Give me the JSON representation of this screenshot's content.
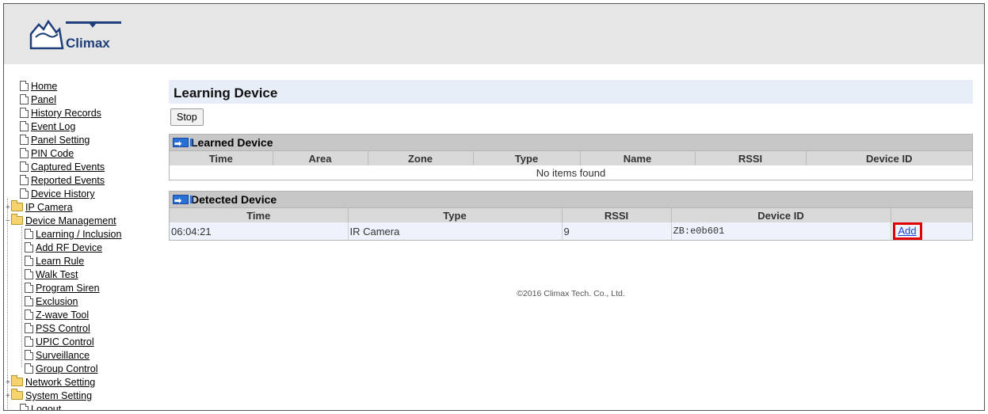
{
  "brand": {
    "logo_text": "Climax"
  },
  "sidebar": {
    "items": [
      {
        "label": "Home"
      },
      {
        "label": "Panel"
      },
      {
        "label": "History Records"
      },
      {
        "label": "Event Log"
      },
      {
        "label": "Panel Setting"
      },
      {
        "label": "PIN Code"
      },
      {
        "label": "Captured Events"
      },
      {
        "label": "Reported Events"
      },
      {
        "label": "Device History"
      },
      {
        "label": "IP Camera"
      },
      {
        "label": "Device Management"
      },
      {
        "label": "Learning / Inclusion"
      },
      {
        "label": "Add RF Device"
      },
      {
        "label": "Learn Rule"
      },
      {
        "label": "Walk Test"
      },
      {
        "label": "Program Siren"
      },
      {
        "label": "Exclusion"
      },
      {
        "label": "Z-wave Tool"
      },
      {
        "label": "PSS Control"
      },
      {
        "label": "UPIC Control"
      },
      {
        "label": "Surveillance"
      },
      {
        "label": "Group Control"
      },
      {
        "label": "Network Setting"
      },
      {
        "label": "System Setting"
      },
      {
        "label": "Logout"
      }
    ],
    "expander_plus": "+",
    "expander_minus": "−"
  },
  "main": {
    "title": "Learning Device",
    "stop_label": "Stop",
    "learned": {
      "heading": "Learned Device",
      "columns": [
        "Time",
        "Area",
        "Zone",
        "Type",
        "Name",
        "RSSI",
        "Device ID"
      ],
      "empty_text": "No items found"
    },
    "detected": {
      "heading": "Detected Device",
      "columns": [
        "Time",
        "Type",
        "RSSI",
        "Device ID",
        ""
      ],
      "rows": [
        {
          "time": "06:04:21",
          "type": "IR Camera",
          "rssi": "9",
          "device_id": "ZB:e0b601",
          "action": "Add"
        }
      ]
    }
  },
  "footer": {
    "copyright": "©2016 Climax Tech. Co., Ltd."
  },
  "colors": {
    "accent_blue": "#2a6fd6",
    "highlight_red": "#e00000",
    "title_bg": "#e8eef8"
  }
}
